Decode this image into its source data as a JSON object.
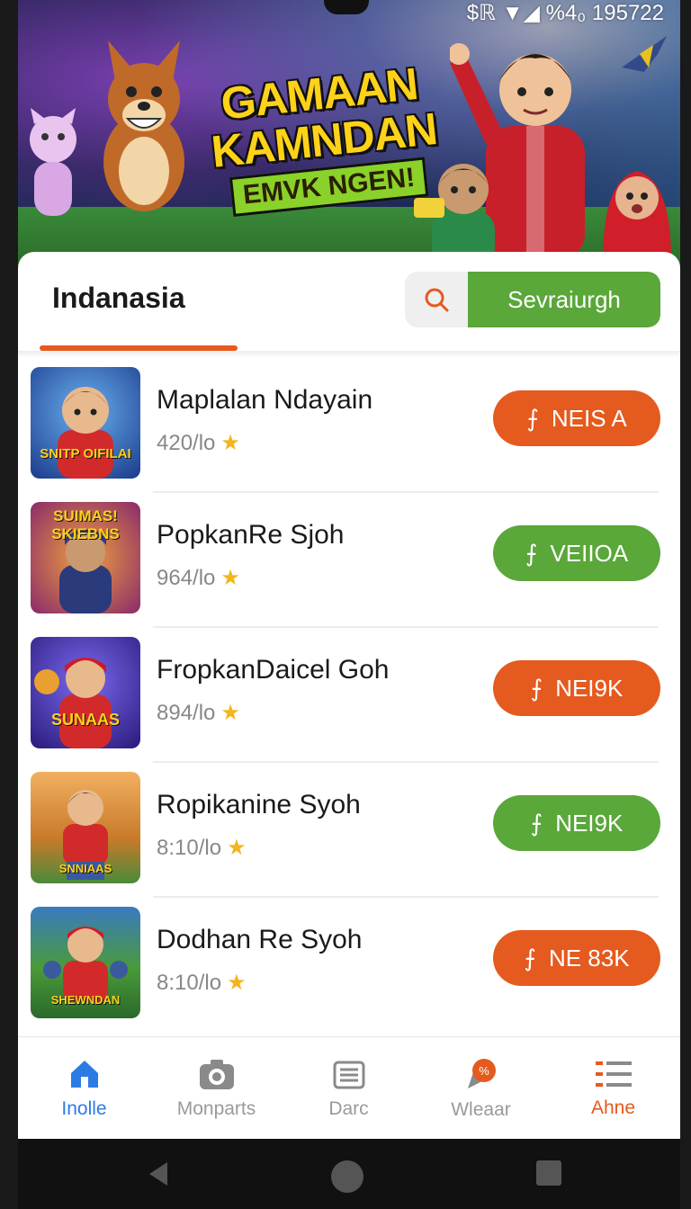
{
  "status_bar": {
    "text": "$ℝ ▼◢ %4₀ 195722"
  },
  "banner": {
    "line1": "GAMAAN",
    "line2": "KAMNDAN",
    "line3": "EMVK NGEN!"
  },
  "header": {
    "tab_title": "Indanasia",
    "search_label": "Sevraiurgh",
    "search_icon": "search-icon",
    "accent": "#e55a1e",
    "green": "#5aa73a"
  },
  "apps": [
    {
      "name": "Maplalan Ndayain",
      "rating": "420/lo",
      "button": "NEIS A",
      "color": "#e55a1e",
      "thumb_text": "SNITP OIFILAI"
    },
    {
      "name": "PopkanRe Sjoh",
      "rating": "964/lo",
      "button": "VEIIOA",
      "color": "#5aa73a",
      "thumb_text": "SUIMAS! SKIEBNS"
    },
    {
      "name": "FropkanDaicel Goh",
      "rating": "894/lo",
      "button": "NEI9K",
      "color": "#e55a1e",
      "thumb_text": "SUNAAS"
    },
    {
      "name": "Ropikanine Syoh",
      "rating": "8:10/lo",
      "button": "NEI9K",
      "color": "#5aa73a",
      "thumb_text": "SNNIAAS"
    },
    {
      "name": "Dodhan Re Syoh",
      "rating": "8:10/lo",
      "button": "NE 83K",
      "color": "#e55a1e",
      "thumb_text": "SHEWNDAN"
    }
  ],
  "bottom_nav": [
    {
      "label": "Inolle",
      "icon": "home-icon"
    },
    {
      "label": "Monparts",
      "icon": "camera-icon"
    },
    {
      "label": "Darc",
      "icon": "print-icon"
    },
    {
      "label": "Wleaar",
      "icon": "badge-icon"
    },
    {
      "label": "Ahne",
      "icon": "menu-list-icon"
    }
  ]
}
